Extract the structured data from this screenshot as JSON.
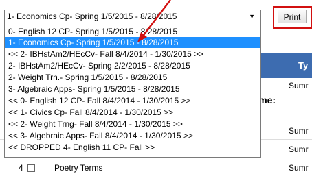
{
  "select": {
    "selected": "1- Economics Cp- Spring 1/5/2015 - 8/28/2015",
    "options": [
      "0- English 12 CP- Spring 1/5/2015 - 8/28/2015",
      "1- Economics Cp- Spring 1/5/2015 - 8/28/2015",
      "<< 2- IBHstAm2/HEcCv- Fall 8/4/2014 - 1/30/2015 >>",
      "2- IBHstAm2/HEcCv- Spring 2/2/2015 - 8/28/2015",
      "2- Weight Trn.- Spring 1/5/2015 - 8/28/2015",
      "3- Algebraic Apps- Spring 1/5/2015 - 8/28/2015",
      "<< 0- English 12 CP- Fall 8/4/2014 - 1/30/2015 >>",
      "<< 1- Civics Cp- Fall 8/4/2014 - 1/30/2015 >>",
      "<< 2- Weight Trng- Fall 8/4/2014 - 1/30/2015 >>",
      "<< 3- Algebraic Apps- Fall 8/4/2014 - 1/30/2015 >>",
      "<< DROPPED 4- English 11 CP- Fall >>"
    ]
  },
  "toolbar": {
    "print_label": "Print"
  },
  "table": {
    "header_text": "Ty",
    "time_label": "Time:",
    "sumr_texts": [
      "Sumr",
      "Sumr",
      "Sumr",
      "Sumr"
    ],
    "row": {
      "number": "4",
      "expand": "⊞",
      "title": "Poetry Terms",
      "type": "Sumr"
    }
  },
  "colors": {
    "highlight": "#1e90ff",
    "header": "#3d6cb0",
    "annotation": "#d21010"
  }
}
